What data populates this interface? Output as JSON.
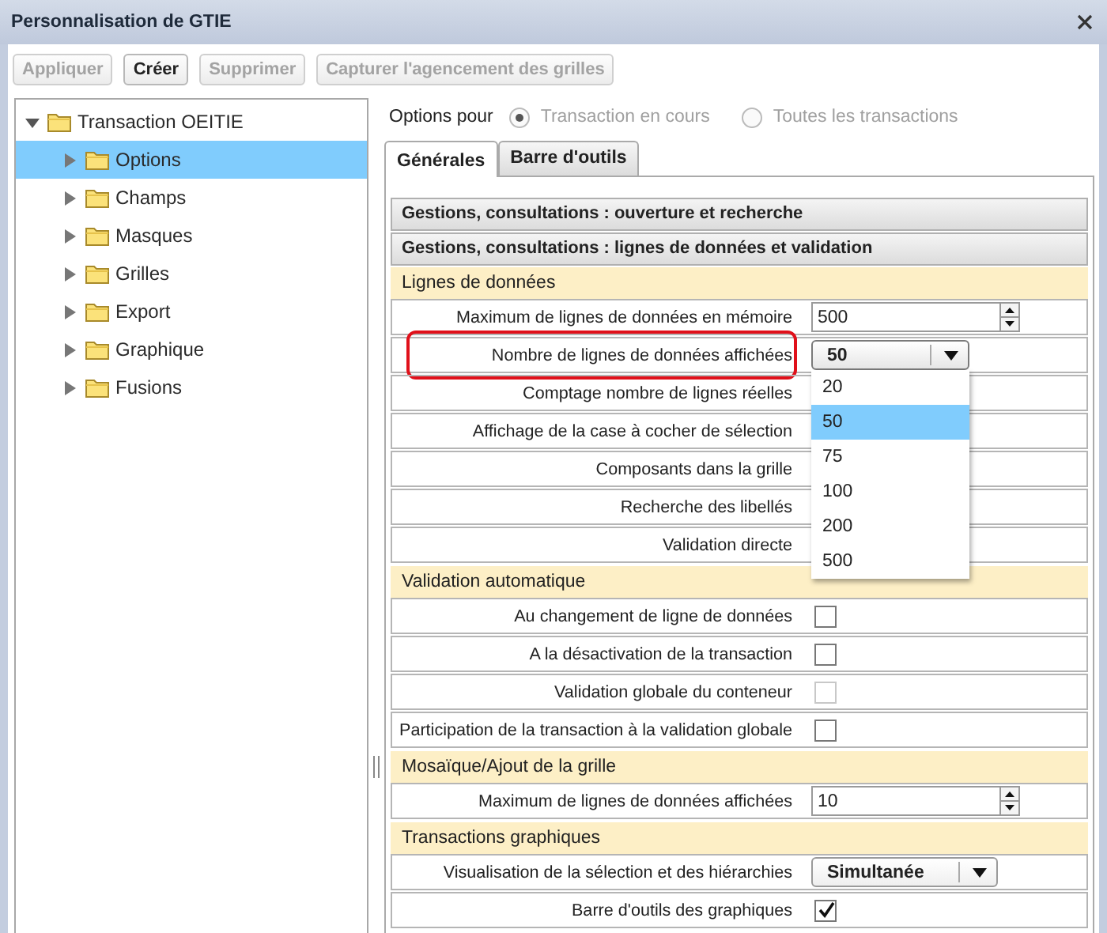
{
  "window": {
    "title": "Personnalisation de GTIE"
  },
  "toolbar": [
    {
      "label": "Appliquer",
      "disabled": true
    },
    {
      "label": "Créer",
      "disabled": false
    },
    {
      "label": "Supprimer",
      "disabled": true
    },
    {
      "label": "Capturer l'agencement des grilles",
      "disabled": true
    }
  ],
  "tree": {
    "label": "Transaction OEITIE",
    "expanded": true,
    "selected": false,
    "children": [
      {
        "label": "Options",
        "expanded": false,
        "selected": true
      },
      {
        "label": "Champs",
        "expanded": false,
        "selected": false
      },
      {
        "label": "Masques",
        "expanded": false,
        "selected": false
      },
      {
        "label": "Grilles",
        "expanded": false,
        "selected": false
      },
      {
        "label": "Export",
        "expanded": false,
        "selected": false
      },
      {
        "label": "Graphique",
        "expanded": false,
        "selected": false
      },
      {
        "label": "Fusions",
        "expanded": false,
        "selected": false
      }
    ]
  },
  "options_for": {
    "label": "Options pour",
    "radios": [
      {
        "label": "Transaction en cours",
        "selected": true,
        "disabled": true
      },
      {
        "label": "Toutes les transactions",
        "selected": false,
        "disabled": true
      }
    ]
  },
  "tabs": [
    {
      "label": "Générales",
      "selected": true
    },
    {
      "label": "Barre d'outils",
      "selected": false
    }
  ],
  "sections": [
    {
      "title": "Gestions, consultations : ouverture et recherche"
    },
    {
      "title": "Gestions, consultations : lignes de données et validation"
    }
  ],
  "groups": [
    {
      "title": "Lignes de données",
      "rows": [
        {
          "label": "Maximum de lignes de données en mémoire",
          "kind": "spinner",
          "value": "500",
          "highlighted": false
        },
        {
          "label": "Nombre de lignes de données affichées",
          "kind": "dropdown",
          "value": "50",
          "highlighted": true,
          "expanded": true,
          "options": [
            {
              "label": "20",
              "selected": false
            },
            {
              "label": "50",
              "selected": true
            },
            {
              "label": "75",
              "selected": false
            },
            {
              "label": "100",
              "selected": false
            },
            {
              "label": "200",
              "selected": false
            },
            {
              "label": "500",
              "selected": false
            }
          ]
        },
        {
          "label": "Comptage nombre de lignes réelles",
          "kind": "hidden",
          "highlighted": false
        },
        {
          "label": "Affichage de la case à cocher de sélection",
          "kind": "hidden",
          "highlighted": false
        },
        {
          "label": "Composants dans la grille",
          "kind": "hidden",
          "highlighted": false
        },
        {
          "label": "Recherche des libellés",
          "kind": "hidden",
          "highlighted": false
        },
        {
          "label": "Validation directe",
          "kind": "hidden",
          "highlighted": false
        }
      ]
    },
    {
      "title": "Validation automatique",
      "rows": [
        {
          "label": "Au changement de ligne de données",
          "kind": "checkbox",
          "checked": false,
          "disabled": false,
          "highlighted": false
        },
        {
          "label": "A la désactivation de la transaction",
          "kind": "checkbox",
          "checked": false,
          "disabled": false,
          "highlighted": false
        },
        {
          "label": "Validation globale du conteneur",
          "kind": "checkbox",
          "checked": false,
          "disabled": true,
          "highlighted": false
        },
        {
          "label": "Participation de la transaction à la validation globale",
          "kind": "checkbox",
          "checked": false,
          "disabled": false,
          "highlighted": false
        }
      ]
    },
    {
      "title": "Mosaïque/Ajout de la grille",
      "rows": [
        {
          "label": "Maximum de lignes de données affichées",
          "kind": "spinner",
          "value": "10",
          "highlighted": false
        }
      ]
    },
    {
      "title": "Transactions graphiques",
      "rows": [
        {
          "label": "Visualisation de la sélection et des hiérarchies",
          "kind": "dropdown",
          "value": "Simultanée",
          "highlighted": false,
          "expanded": false
        },
        {
          "label": "Barre d'outils des graphiques",
          "kind": "checkbox",
          "checked": true,
          "disabled": false,
          "highlighted": false
        }
      ]
    }
  ]
}
